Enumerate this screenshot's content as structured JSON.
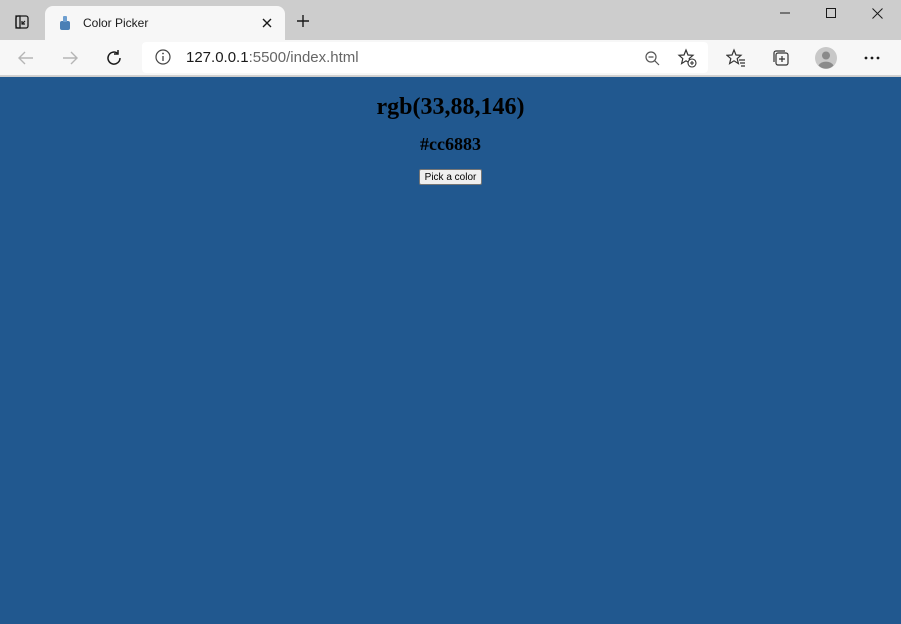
{
  "browser": {
    "tab": {
      "title": "Color Picker"
    },
    "address": {
      "host": "127.0.0.1",
      "path": ":5500/index.html"
    }
  },
  "page": {
    "background_color": "#21588f",
    "rgb_text": "rgb(33,88,146)",
    "hex_text": "#cc6883",
    "button_label": "Pick a color"
  },
  "icons": {
    "tab_actions": "tab-actions-icon",
    "favicon": "paint-bucket-icon",
    "tab_close": "close-icon",
    "new_tab": "plus-icon",
    "minimize": "minimize-icon",
    "maximize": "maximize-icon",
    "close": "close-icon",
    "back": "arrow-left-icon",
    "forward": "arrow-right-icon",
    "refresh": "refresh-icon",
    "info": "info-icon",
    "zoom": "zoom-out-icon",
    "add_favorite": "star-plus-icon",
    "favorites": "favorites-list-icon",
    "collections": "collections-icon",
    "profile": "avatar-icon",
    "more": "more-icon"
  }
}
